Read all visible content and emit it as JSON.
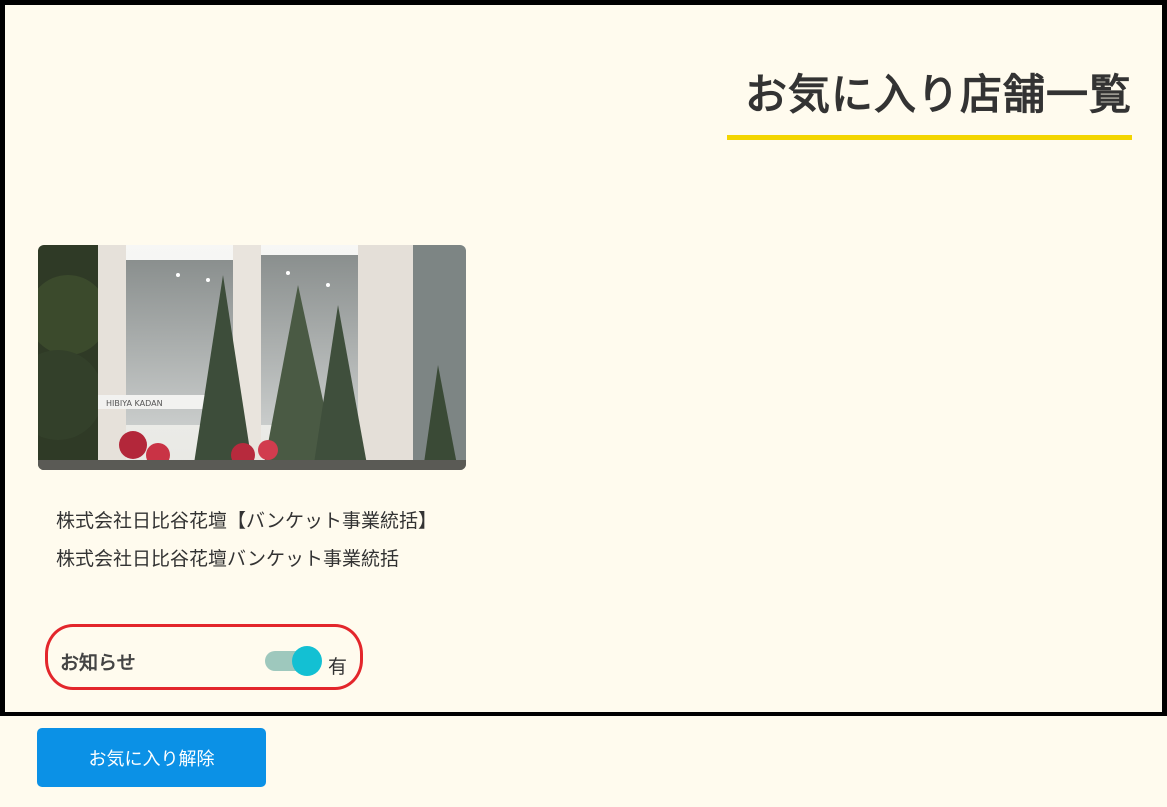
{
  "page": {
    "title": "お気に入り店舗一覧"
  },
  "favorites": [
    {
      "shop_name": "株式会社日比谷花壇【バンケット事業統括】 株式会社日比谷花壇バンケット事業統括",
      "image_sign_text": "HIBIYA KADAN",
      "notification_label": "お知らせ",
      "notification_enabled": true,
      "notification_state_text": "有"
    }
  ],
  "actions": {
    "remove_favorite_label": "お気に入り解除"
  },
  "colors": {
    "accent_underline": "#f3d500",
    "toggle_knob": "#13c0d3",
    "toggle_track": "#9ec8bd",
    "button_primary": "#0b91e6",
    "highlight_annotation": "#e3262b",
    "background": "#fffbee"
  }
}
